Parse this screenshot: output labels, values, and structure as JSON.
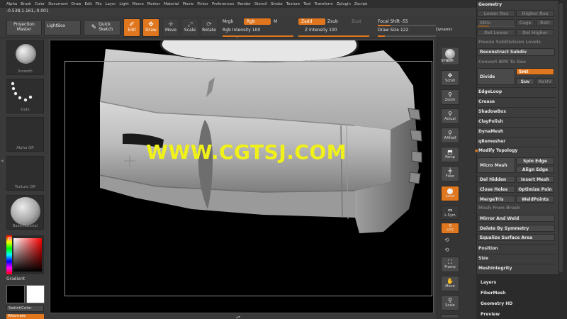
{
  "menubar": [
    "Alpha",
    "Brush",
    "Color",
    "Document",
    "Draw",
    "Edit",
    "File",
    "Layer",
    "Light",
    "Macro",
    "Marker",
    "Material",
    "Movie",
    "Picker",
    "Preferences",
    "Render",
    "Stencil",
    "Stroke",
    "Texture",
    "Tool",
    "Transform",
    "Zplugin",
    "Zscript"
  ],
  "coords": "-0.538,1.161,-0.001",
  "toolbar": {
    "projection_master": "Projection\nMaster",
    "lightbox": "LightBox",
    "quick_sketch": "Quick\nSketch",
    "edit": "Edit",
    "draw": "Draw",
    "move": "Move",
    "scale": "Scale",
    "rotate": "Rotate",
    "mrgb": "Mrgb",
    "rgb": "Rgb",
    "m": "M",
    "zadd": "Zadd",
    "zsub": "Zsub",
    "zcut": "Zcut",
    "rgb_intensity_label": "Rgb Intensity",
    "rgb_intensity_value": "100",
    "z_intensity_label": "Z Intensity",
    "z_intensity_value": "100",
    "focal_shift_label": "Focal Shift",
    "focal_shift_value": "-55",
    "draw_size_label": "Draw Size",
    "draw_size_value": "122",
    "dynamic": "Dynamic"
  },
  "leftpanel": {
    "brush": "Smooth",
    "stroke": "Dots",
    "alpha": "Alpha Off",
    "texture": "Texture Off",
    "material": "BasicMaterial",
    "gradient": "Gradient",
    "switch_color": "SwitchColor",
    "alternate": "Alternate"
  },
  "canvas": {
    "watermark": "WWW.CGTSJ.COM"
  },
  "rshelf": {
    "bpr": "BPR",
    "spix_label": "SPix",
    "spix_value": "3",
    "scroll": "Scroll",
    "zoom": "Zoom",
    "actual": "Actual",
    "aahalf": "AAHalf",
    "persp": "Persp",
    "floor": "Floor",
    "local": "Local",
    "lsym": "L.Sym",
    "xyz": "XYZ",
    "frame": "Frame",
    "move": "Move",
    "scale": "Scale"
  },
  "rpanel": {
    "geometry": "Geometry",
    "lower_res": "Lower Res",
    "higher_res": "Higher Res",
    "sdiv": "SDiv",
    "cage": "Cage",
    "rstr": "Rstr",
    "del_lower": "Del Lower",
    "del_higher": "Del Higher",
    "freeze_subdiv": "Freeze SubDivision Levels",
    "reconstruct_subdiv": "Reconstruct Subdiv",
    "convert_bpr": "Convert BPR To Geo",
    "divide": "Divide",
    "smt": "Smt",
    "suv": "Suv",
    "reuv": "ReUV",
    "edgeloop": "EdgeLoop",
    "crease": "Crease",
    "shadowbox": "ShadowBox",
    "claypolish": "ClayPolish",
    "dynamesh": "DynaMesh",
    "qremesher": "qRemesher",
    "modify_topology": "Modify Topology",
    "micro_mesh": "Micro Mesh",
    "spin_edge": "Spin Edge",
    "align_edge": "Align Edge",
    "del_hidden": "Del Hidden",
    "insert_mesh": "Insert Mesh",
    "close_holes": "Close Holes",
    "optimize_points": "Optimize Poin",
    "mergetris": "MergeTris",
    "weldpoints": "WeldPoints",
    "mesh_from_brush": "Mesh From Brush",
    "mirror_and_weld": "Mirror And Weld",
    "delete_by_symmetry": "Delete By Symmetry",
    "equalize_surface_area": "Equalize Surface Area",
    "position": "Position",
    "size": "Size",
    "meshintegrity": "MeshIntegrity",
    "layers": "Layers",
    "fibermesh": "FiberMesh",
    "geometry_hd": "Geometry HD",
    "preview": "Preview"
  },
  "colors": {
    "accent": "#e0761e",
    "watermark": "#f0f01a"
  }
}
